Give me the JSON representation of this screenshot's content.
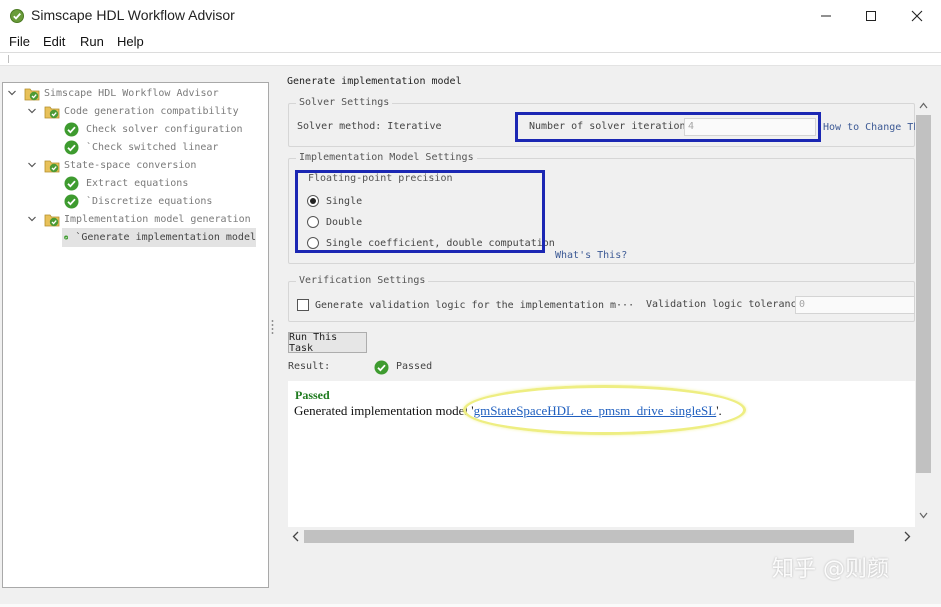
{
  "window": {
    "title": "Simscape HDL Workflow Advisor"
  },
  "menu": [
    "File",
    "Edit",
    "Run",
    "Help"
  ],
  "tree": {
    "root": "Simscape HDL Workflow Advisor",
    "groups": [
      {
        "label": "Code generation compatibility",
        "items": [
          "Check solver configuration",
          "`Check switched linear"
        ]
      },
      {
        "label": "State-space conversion",
        "items": [
          "Extract equations",
          "`Discretize equations"
        ]
      },
      {
        "label": "Implementation model generation",
        "items": [
          "`Generate implementation model"
        ]
      }
    ],
    "selected": "`Generate implementation model"
  },
  "panel": {
    "title": "Generate implementation model",
    "solver": {
      "legend": "Solver Settings",
      "method_label": "Solver method: Iterative",
      "iterations_label": "Number of solver iterations",
      "iterations_value": "4",
      "how_to_link": "How to Change Thi"
    },
    "impl": {
      "legend": "Implementation Model Settings",
      "precision_legend": "Floating-point precision",
      "options": [
        "Single",
        "Double",
        "Single coefficient, double computation"
      ],
      "selected": "Single",
      "whats_this": "What's This?"
    },
    "verification": {
      "legend": "Verification Settings",
      "checkbox_label": "Generate validation logic for the implementation m···",
      "checked": false,
      "tolerance_label": "Validation logic tolerance",
      "tolerance_value": "0"
    },
    "run_button": "Run This Task",
    "result_label": "Result:",
    "result_value": "Passed",
    "report": {
      "status": "Passed",
      "message_prefix": "Generated implementation model '",
      "model_link": "gmStateSpaceHDL_ee_pmsm_drive_singleSL",
      "message_suffix": "'."
    }
  },
  "watermark": "知乎 @则颜",
  "colors": {
    "highlight_box": "#1b27b3",
    "highlight_ellipse": "#eeee82",
    "pass_green": "#1e7a1e",
    "link": "#1f5fbf"
  }
}
